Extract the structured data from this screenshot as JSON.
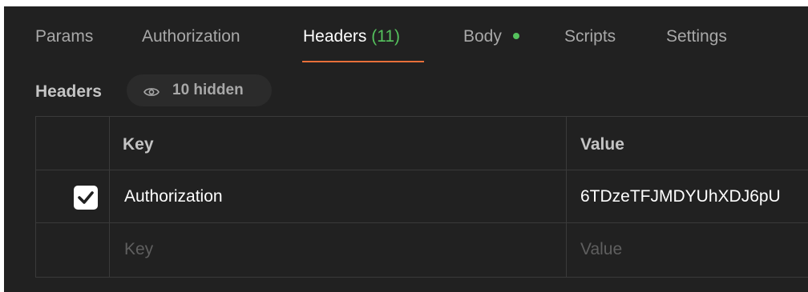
{
  "tabs": [
    {
      "label": "Params"
    },
    {
      "label": "Authorization"
    },
    {
      "label": "Headers",
      "count": "(11)"
    },
    {
      "label": "Body"
    },
    {
      "label": "Scripts"
    },
    {
      "label": "Settings"
    }
  ],
  "active_tab": "Headers",
  "body_indicator_color": "#55c25d",
  "accent_color": "#e8703a",
  "headers_section": {
    "title": "Headers",
    "hidden_toggle": {
      "icon": "eye-icon",
      "label": "10 hidden"
    }
  },
  "table": {
    "columns": [
      "Key",
      "Value"
    ],
    "rows": [
      {
        "checked": true,
        "key": "Authorization",
        "value": "6TDzeTFJMDYUhXDJ6pU"
      }
    ],
    "new_row": {
      "key_placeholder": "Key",
      "value_placeholder": "Value"
    }
  }
}
